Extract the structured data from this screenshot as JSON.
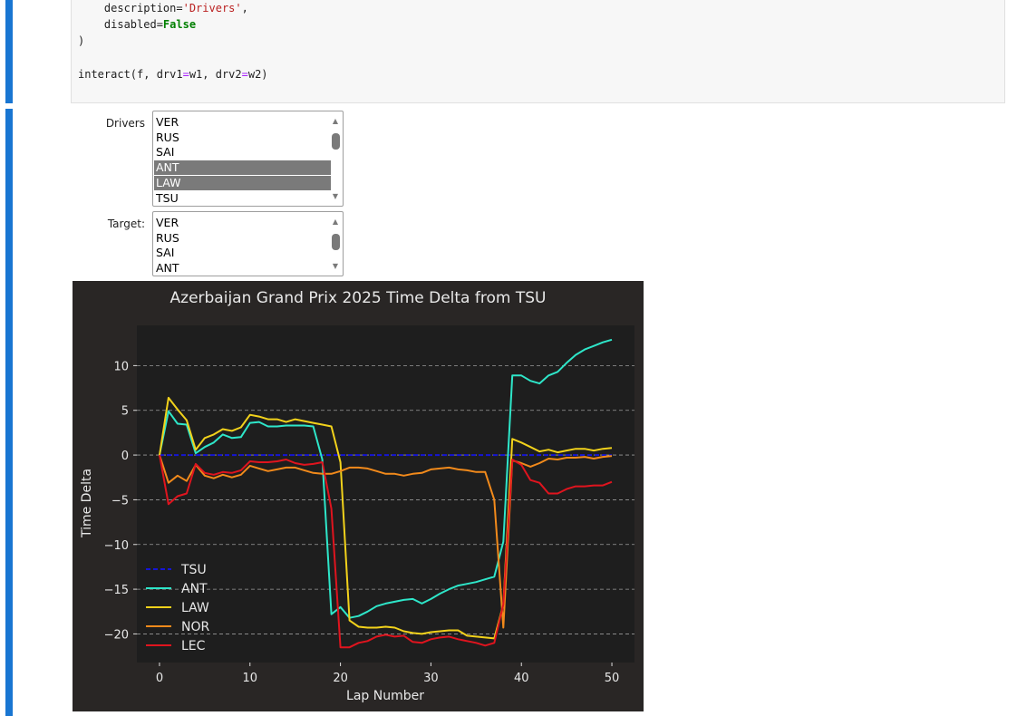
{
  "code": {
    "lines": [
      {
        "pre": "    description=",
        "str": "'Drivers'",
        "post": ","
      },
      {
        "pre": "    disabled=",
        "kw": "False"
      },
      {
        "pre": ")"
      },
      {
        "pre": ""
      },
      {
        "pre": "interact(f, drv1",
        "op1": "=",
        "mid": "w1, drv2",
        "op2": "=",
        "post": "w2)"
      }
    ]
  },
  "widgets": {
    "drivers": {
      "label": "Drivers",
      "options": [
        "VER",
        "RUS",
        "SAI",
        "ANT",
        "LAW",
        "TSU"
      ],
      "selected": [
        "ANT",
        "LAW"
      ]
    },
    "target": {
      "label": "Target:",
      "options": [
        "VER",
        "RUS",
        "SAI",
        "ANT"
      ],
      "selected": []
    }
  },
  "chart_data": {
    "type": "line",
    "title": "Azerbaijan Grand Prix 2025 Time Delta from TSU",
    "xlabel": "Lap Number",
    "ylabel": "Time Delta",
    "xlim": [
      -2.5,
      52.5
    ],
    "ylim": [
      -23.2,
      14.5
    ],
    "xticks": [
      0,
      10,
      20,
      30,
      40,
      50
    ],
    "yticks": [
      10,
      5,
      0,
      -5,
      -10,
      -15,
      -20
    ],
    "grid": "horizontal dashed",
    "legend": "bottom-left",
    "background": "#292625",
    "axes_background": "#1e1e1e",
    "series": [
      {
        "name": "TSU",
        "color": "#1515d6",
        "dashed": true,
        "x": [
          0,
          50
        ],
        "values": [
          0,
          0
        ]
      },
      {
        "name": "ANT",
        "color": "#2ee6c9",
        "x": [
          0,
          1,
          2,
          3,
          4,
          5,
          6,
          7,
          8,
          9,
          10,
          11,
          12,
          13,
          14,
          15,
          16,
          17,
          18,
          19,
          20,
          21,
          22,
          23,
          24,
          25,
          26,
          27,
          28,
          29,
          30,
          31,
          32,
          33,
          34,
          35,
          36,
          37,
          38,
          39,
          40,
          41,
          42,
          43,
          44,
          45,
          46,
          47,
          48,
          49,
          50
        ],
        "values": [
          0,
          4.9,
          3.5,
          3.4,
          0.2,
          0.9,
          1.4,
          2.3,
          1.9,
          2.0,
          3.6,
          3.7,
          3.2,
          3.2,
          3.3,
          3.3,
          3.3,
          3.2,
          -0.5,
          -17.8,
          -17.0,
          -18.2,
          -18.0,
          -17.5,
          -16.9,
          -16.6,
          -16.4,
          -16.2,
          -16.1,
          -16.6,
          -16.1,
          -15.5,
          -15.0,
          -14.6,
          -14.4,
          -14.2,
          -13.9,
          -13.6,
          -9.7,
          8.9,
          8.9,
          8.3,
          8.0,
          8.9,
          9.3,
          10.3,
          11.2,
          11.8,
          12.2,
          12.6,
          12.9
        ]
      },
      {
        "name": "LAW",
        "color": "#f2d21b",
        "x": [
          0,
          1,
          2,
          3,
          4,
          5,
          6,
          7,
          8,
          9,
          10,
          11,
          12,
          13,
          14,
          15,
          16,
          17,
          18,
          19,
          20,
          21,
          22,
          23,
          24,
          25,
          26,
          27,
          28,
          29,
          30,
          31,
          32,
          33,
          34,
          35,
          36,
          37,
          38,
          39,
          40,
          41,
          42,
          43,
          44,
          45,
          46,
          47,
          48,
          49,
          50
        ],
        "values": [
          0,
          6.4,
          5.1,
          3.9,
          0.6,
          1.9,
          2.3,
          2.9,
          2.7,
          3.1,
          4.5,
          4.3,
          4.0,
          4.0,
          3.7,
          4.0,
          3.8,
          3.6,
          3.4,
          3.2,
          -0.8,
          -18.5,
          -19.2,
          -19.3,
          -19.3,
          -19.2,
          -19.3,
          -19.7,
          -19.9,
          -20.0,
          -19.8,
          -19.7,
          -19.6,
          -19.6,
          -20.2,
          -20.3,
          -20.4,
          -20.5,
          -16.7,
          1.8,
          1.4,
          0.9,
          0.4,
          0.6,
          0.3,
          0.5,
          0.7,
          0.7,
          0.5,
          0.7,
          0.8
        ]
      },
      {
        "name": "NOR",
        "color": "#f28a1b",
        "x": [
          0,
          1,
          2,
          3,
          4,
          5,
          6,
          7,
          8,
          9,
          10,
          11,
          12,
          13,
          14,
          15,
          16,
          17,
          18,
          19,
          20,
          21,
          22,
          23,
          24,
          25,
          26,
          27,
          28,
          29,
          30,
          31,
          32,
          33,
          34,
          35,
          36,
          37,
          38,
          39,
          40,
          41,
          42,
          43,
          44,
          45,
          46,
          47,
          48,
          49,
          50
        ],
        "values": [
          0,
          -3.1,
          -2.3,
          -2.9,
          -1.1,
          -2.3,
          -2.6,
          -2.2,
          -2.5,
          -2.2,
          -1.2,
          -1.5,
          -1.8,
          -1.6,
          -1.4,
          -1.4,
          -1.7,
          -2.0,
          -2.1,
          -2.1,
          -1.8,
          -1.4,
          -1.4,
          -1.5,
          -1.8,
          -2.1,
          -2.1,
          -2.3,
          -2.1,
          -2.0,
          -1.6,
          -1.5,
          -1.4,
          -1.6,
          -1.7,
          -1.9,
          -1.9,
          -5.0,
          -19.3,
          -0.6,
          -0.9,
          -1.3,
          -0.9,
          -0.4,
          -0.5,
          -0.3,
          -0.3,
          -0.2,
          -0.4,
          -0.2,
          -0.1
        ]
      },
      {
        "name": "LEC",
        "color": "#e0141e",
        "x": [
          0,
          1,
          2,
          3,
          4,
          5,
          6,
          7,
          8,
          9,
          10,
          11,
          12,
          13,
          14,
          15,
          16,
          17,
          18,
          19,
          20,
          21,
          22,
          23,
          24,
          25,
          26,
          27,
          28,
          29,
          30,
          31,
          32,
          33,
          34,
          35,
          36,
          37,
          38,
          39,
          40,
          41,
          42,
          43,
          44,
          45,
          46,
          47,
          48,
          49,
          50
        ],
        "values": [
          0,
          -5.5,
          -4.6,
          -4.3,
          -1.0,
          -2.0,
          -2.2,
          -1.9,
          -2.0,
          -1.7,
          -0.7,
          -0.8,
          -0.8,
          -0.7,
          -0.5,
          -0.9,
          -1.1,
          -1.0,
          -0.8,
          -6.0,
          -21.5,
          -21.5,
          -21.0,
          -20.8,
          -20.3,
          -20.1,
          -20.3,
          -20.2,
          -20.9,
          -21.0,
          -20.6,
          -20.4,
          -20.3,
          -20.6,
          -20.8,
          -21.0,
          -21.3,
          -21.0,
          -16.7,
          -0.5,
          -1.1,
          -2.8,
          -3.1,
          -4.3,
          -4.3,
          -3.8,
          -3.5,
          -3.5,
          -3.4,
          -3.4,
          -3.0
        ]
      }
    ]
  }
}
